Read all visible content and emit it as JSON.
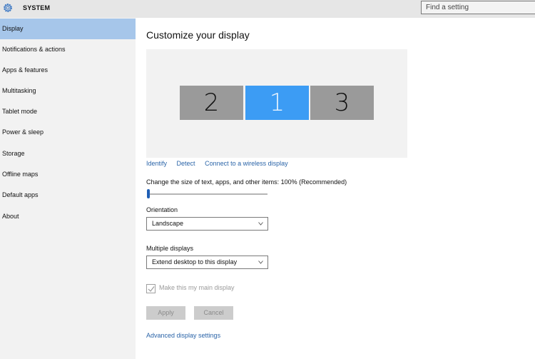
{
  "header": {
    "app_title": "SYSTEM",
    "icon": "gear-icon",
    "search_placeholder": "Find a setting",
    "search_value": ""
  },
  "sidebar": {
    "active_index": 0,
    "items": [
      {
        "label": "Display"
      },
      {
        "label": "Notifications & actions"
      },
      {
        "label": "Apps & features"
      },
      {
        "label": "Multitasking"
      },
      {
        "label": "Tablet mode"
      },
      {
        "label": "Power & sleep"
      },
      {
        "label": "Storage"
      },
      {
        "label": "Offline maps"
      },
      {
        "label": "Default apps"
      },
      {
        "label": "About"
      }
    ]
  },
  "main": {
    "title": "Customize your display",
    "monitors": [
      {
        "label": "2",
        "selected": false
      },
      {
        "label": "1",
        "selected": true
      },
      {
        "label": "3",
        "selected": false
      }
    ],
    "links": {
      "identify": "Identify",
      "detect": "Detect",
      "wireless": "Connect to a wireless display"
    },
    "scale": {
      "label": "Change the size of text, apps, and other items: 100% (Recommended)",
      "value_percent": 100,
      "slider_position": 0
    },
    "orientation": {
      "label": "Orientation",
      "selected": "Landscape"
    },
    "multiple_displays": {
      "label": "Multiple displays",
      "selected": "Extend desktop to this display"
    },
    "main_display_checkbox": {
      "label": "Make this my main display",
      "checked": true,
      "disabled": true
    },
    "buttons": {
      "apply": "Apply",
      "cancel": "Cancel"
    },
    "advanced_link": "Advanced display settings"
  },
  "colors": {
    "accent": "#3c9cf4",
    "sidebar_active": "#a6c6ea",
    "link": "#2a64a8",
    "monitor_inactive": "#9a9a9a"
  }
}
